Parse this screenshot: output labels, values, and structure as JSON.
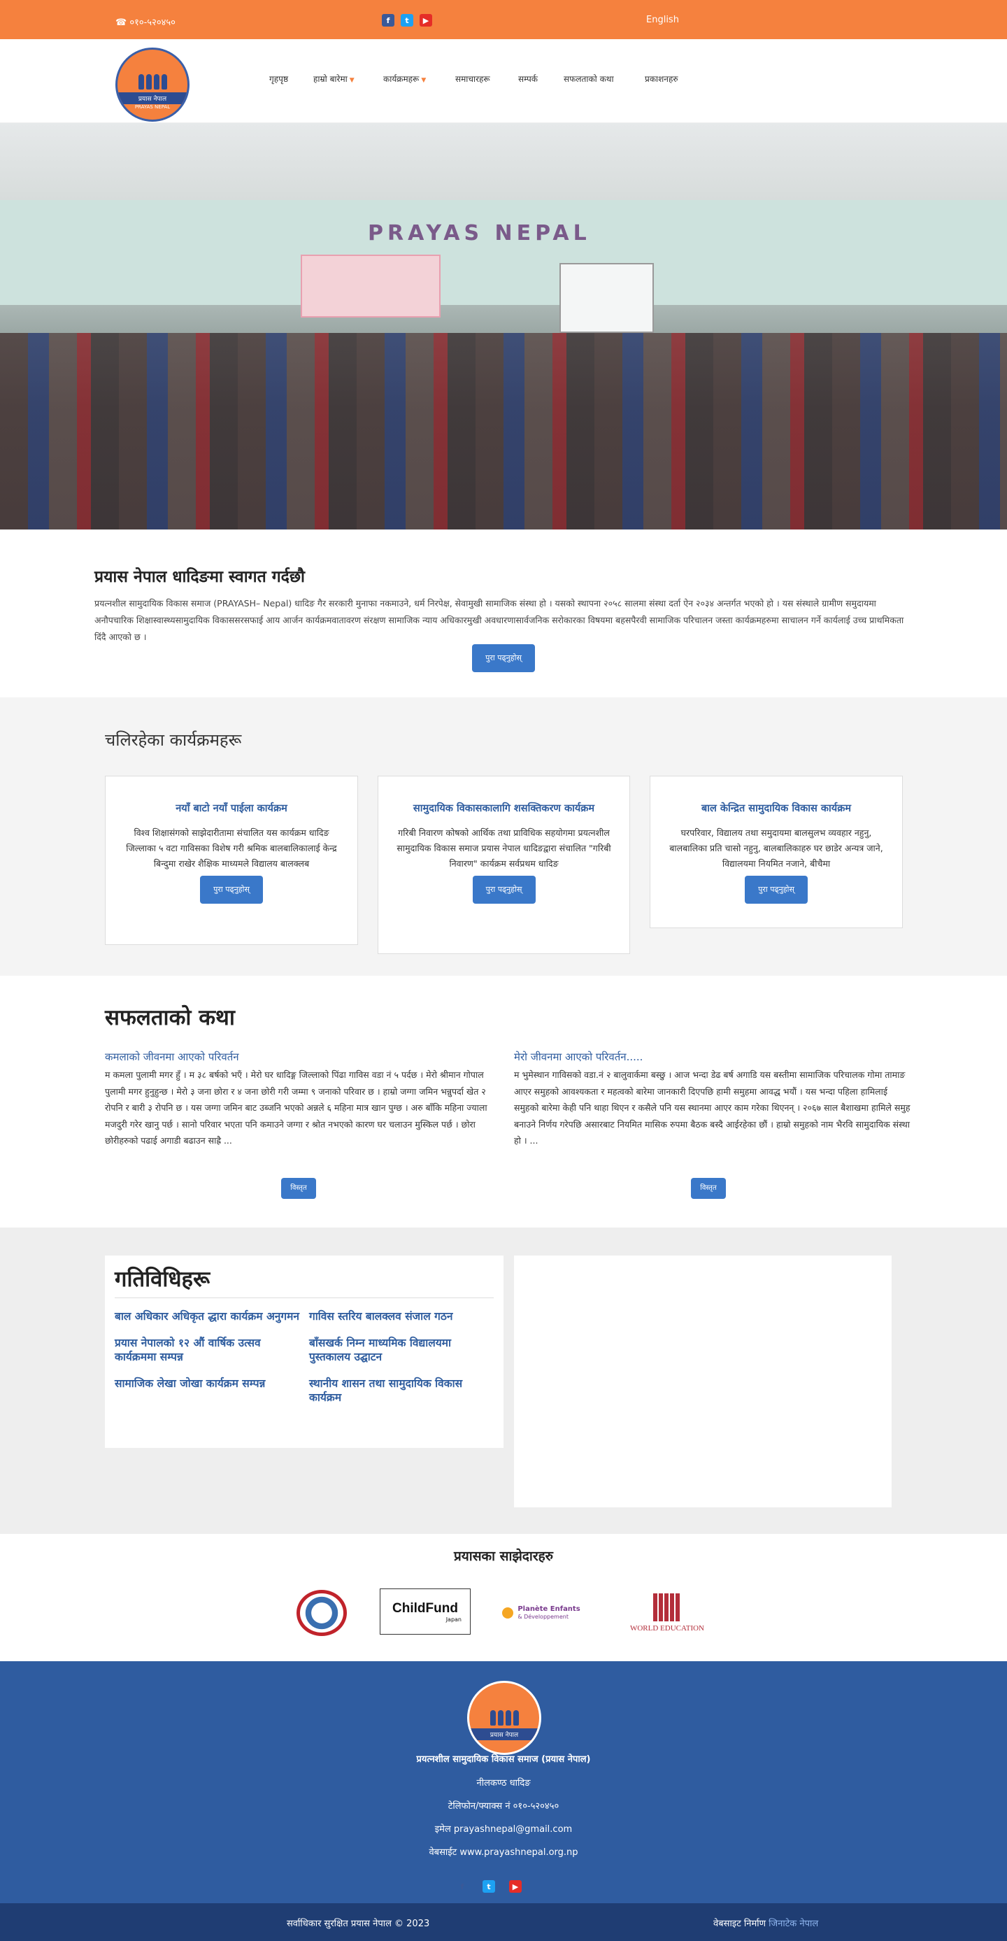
{
  "topbar": {
    "phone": "☎ ०१०-५२०४५०",
    "language": "English",
    "social": [
      "facebook-icon",
      "twitter-icon",
      "youtube-icon"
    ]
  },
  "logo": {
    "line1": "प्रयास नेपाल",
    "line2": "PRAYAS NEPAL"
  },
  "nav": {
    "items": [
      {
        "label": "गृहपृष्ठ",
        "dropdown": false
      },
      {
        "label": "हाम्रो बारेमा",
        "dropdown": true
      },
      {
        "label": "कार्यक्रमहरू",
        "dropdown": true
      },
      {
        "label": "समाचारहरू",
        "dropdown": false
      },
      {
        "label": "सम्पर्क",
        "dropdown": false
      },
      {
        "label": "सफलताको कथा",
        "dropdown": false
      },
      {
        "label": "प्रकाशनहरु",
        "dropdown": false
      }
    ]
  },
  "hero": {
    "banner_text": "PRAYAS NEPAL"
  },
  "welcome": {
    "title": "प्रयास नेपाल धादिङमा स्वागत गर्दछौ",
    "body": "प्रयत्नशील सामुदायिक विकास समाज (PRAYASH– Nepal) धादिङ गैर सरकारी मुनाफा नकमाउने, धर्म निरपेक्ष, सेवामुखी सामाजिक संस्था हो । यसको स्थापना २०५८ सालमा संस्था दर्ता ऐन २०३४ अन्तर्गत भएको हो । यस संस्थाले ग्रामीण समुदायमा अनौपचारिक शिक्षास्वास्थ्यसामुदायिक विकाससरसफाई आय आर्जन कार्यक्रमवातावरण संरक्षण सामाजिक न्याय अधिकारमुखी अवधारणासार्वजनिक सरोकारका विषयमा बहसपैरवी सामाजिक परिचालन जस्ता कार्यक्रमहरुमा साचालन गर्ने कार्यलाई उच्च प्राथमिकता दिंदै आएको छ ।",
    "button": "पुरा पढ्नुहोस्"
  },
  "programs": {
    "heading": "चलिरहेका कार्यक्रमहरू",
    "cards": [
      {
        "title": "नयाँ बाटो नयाँ पाईला कार्यक्रम",
        "body": "विश्व शिक्षासंगको साझेदारीतामा संचालित यस कार्यक्रम धादिङ जिल्लाका ५ वटा गाविसका विशेष गरी श्रमिक बालबालिकालाई केन्द्र बिन्दुमा राखेर शैक्षिक माध्यमले विद्यालय बालक्लब",
        "button": "पुरा पढ्नुहोस्"
      },
      {
        "title": "सामुदायिक विकासकालागि शसक्तिकरण कार्यक्रम",
        "body": "गरिबी निवारण कोषको आर्थिक तथा प्राविधिक सहयोगमा प्रयत्नशील सामुदायिक विकास समाज प्रयास नेपाल धादिङद्वारा संचालित \"गरिबी निवारण\" कार्यक्रम सर्वप्रथम धादिङ",
        "button": "पुरा पढ्नुहोस्"
      },
      {
        "title": "बाल केन्द्रित सामुदायिक विकास कार्यक्रम",
        "body": "घरपरिवार, विद्यालय तथा समुदायमा बालसुलभ व्यवहार नहुनु, बालबालिका प्रति चासो नहुनु, बालबालिकाहरु घर छाडेर अन्यत्र जाने, विद्यालयमा नियमित नजाने, बीचैमा",
        "button": "पुरा पढ्नुहोस्"
      }
    ]
  },
  "stories": {
    "heading": "सफलताको कथा",
    "items": [
      {
        "title": "कमलाको जीवनमा आएको परिवर्तन",
        "body": "म कमला पुलामी मगर हुँ । म ३८ बर्षको भएँ । मेरो घर धादिङ्ग जिल्लाको पिंढा गाविस वडा नं ५ पर्दछ । मेरो श्रीमान गोपाल पुलामी मगर हुनुहुन्छ । मेरो ३ जना छोरा र ४ जना छोरी गरी जम्मा ९ जनाको परिवार छ । हाम्रो जग्गा जमिन भन्नुपर्दा खेत २ रोपनि र बारी ३ रोपनि छ । यस जग्गा जमिन बाट उब्जनि भएको अन्नले ६ महिना मात्र खान पुग्छ । अरु बाँकि महिना ज्याला मजदुरी गरेर खानु पर्छ । सानो परिवार भएता पनि कमाउने जग्गा र श्रोत नभएको कारण घर चलाउन मुस्किल पर्छ । छोरा छोरीहरुको पढाई अगाडी बढाउन साह्रै ...",
        "button": "विस्तृत"
      },
      {
        "title": "मेरो जीवनमा आएको परिवर्तन.....",
        "body": "म भुमेस्थान गाविसको वडा.नं २ बालुवार्कमा बस्छु । आज भन्दा डेढ बर्ष अगाडि यस बस्तीमा सामाजिक परिचालक गोमा तामाङ आएर समुहको आवश्यकता र महत्वको बारेमा जानकारी दिएपछि हामी समुहमा आवद्ध भयौं । यस भन्दा पहिला हामिलाई समुहको बारेमा केही पनि थाहा थिएन र कसैले पनि यस स्थानमा आएर काम गरेका थिएनन् । २०६७ साल बैशाखमा हामिले समुह बनाउने निर्णय गरेपछि असारबाट नियमित मासिक रुपमा बैठक बस्दै आईरहेका छौं । हाम्रो समुहको नाम भैरवि सामुदायिक संस्था हो । ...",
        "button": "विस्तृत"
      }
    ]
  },
  "activities": {
    "heading": "गतिविधिहरू",
    "items": [
      "बाल अधिकार अधिकृत द्धारा कार्यक्रम अनुगमन",
      "गाविस स्तरिय बालक्लव संजाल गठन",
      "प्रयास नेपालको १२ औं वार्षिक उत्सव कार्यक्रममा सम्पन्न",
      "बाँसखर्क निम्न माध्यमिक विद्यालयमा पुस्तकालय उद्घाटन",
      "सामाजिक लेखा जोखा कार्यक्रम सम्पन्न",
      "स्थानीय शासन तथा सामुदायिक विकास कार्यक्रम"
    ]
  },
  "partners": {
    "heading": "प्रयासका साझेदारहरु",
    "logos": [
      {
        "name": "nepal-government-emblem",
        "text": ""
      },
      {
        "name": "childfund-japan-logo",
        "text": "ChildFund",
        "sub": "Japan"
      },
      {
        "name": "planete-enfants-logo",
        "text": "Planète Enfants",
        "sub": "& Développement"
      },
      {
        "name": "world-education-logo",
        "text": "WORLD EDUCATION"
      }
    ]
  },
  "footer": {
    "org_name": "प्रयत्नशील सामुदायिक विकास समाज (प्रयास नेपाल)",
    "address": "नीलकण्ठ धादिङ",
    "phone": "टेलिफोन/फ्याक्स नं ०१०-५२०४५०",
    "email": "इमेल prayashnepal@gmail.com",
    "website": "वेबसाईट www.prayashnepal.org.np",
    "copyright": "सर्वाधिकार सुरक्षित प्रयास नेपाल © 2023",
    "made_by_label": "वेबसाइट निर्माण",
    "made_by": "जिनाटेक नेपाल"
  }
}
